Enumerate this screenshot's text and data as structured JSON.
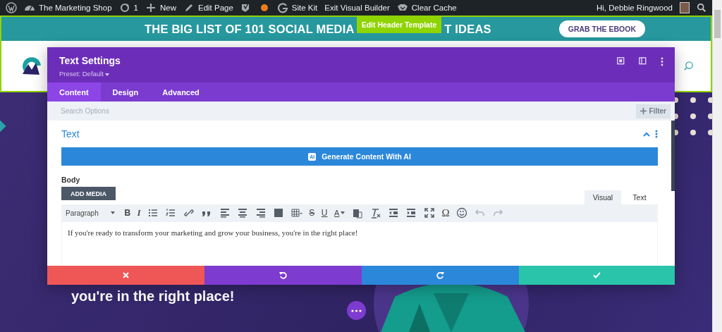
{
  "admin_bar": {
    "items": [
      {
        "kind": "wordpress"
      },
      {
        "kind": "site",
        "label": "The Marketing Shop"
      },
      {
        "kind": "updates",
        "label": "1"
      },
      {
        "kind": "new",
        "label": "New"
      },
      {
        "kind": "edit",
        "label": "Edit Page"
      },
      {
        "kind": "yoast"
      },
      {
        "kind": "status"
      },
      {
        "kind": "sitekit",
        "label": "Site Kit"
      },
      {
        "kind": "plain",
        "label": "Exit Visual Builder"
      },
      {
        "kind": "cache",
        "label": "Clear Cache"
      }
    ],
    "greeting": "Hi, Debbie Ringwood"
  },
  "promo_bar": {
    "text_before": "THE BIG LIST OF 101 SOCIAL MEDIA",
    "badge": "Edit Header Template",
    "text_after": "T IDEAS",
    "button": "GRAB THE EBOOK"
  },
  "hero": {
    "heading": "you're in the right place!"
  },
  "modal": {
    "title": "Text Settings",
    "preset": "Preset: Default",
    "tabs": [
      {
        "label": "Content",
        "selected": true
      },
      {
        "label": "Design",
        "selected": false
      },
      {
        "label": "Advanced",
        "selected": false
      }
    ],
    "search": {
      "placeholder": "Search Options"
    },
    "filter_button": "Filter",
    "section": {
      "title": "Text",
      "expanded": true
    },
    "ai_button": {
      "badge": "AI",
      "label": "Generate Content With AI"
    },
    "body_label": "Body",
    "add_media": "ADD MEDIA",
    "editor_tabs": [
      {
        "label": "Visual",
        "selected": true
      },
      {
        "label": "Text",
        "selected": false
      }
    ],
    "toolbar": [
      {
        "kind": "format",
        "label": "Paragraph",
        "disabled": false
      },
      {
        "kind": "bold",
        "label": "B",
        "disabled": false
      },
      {
        "kind": "italic",
        "label": "I",
        "disabled": false
      },
      {
        "kind": "bullets",
        "disabled": false
      },
      {
        "kind": "numbered",
        "disabled": false
      },
      {
        "kind": "link",
        "disabled": false
      },
      {
        "kind": "quote",
        "disabled": false
      },
      {
        "kind": "alignleft",
        "disabled": false
      },
      {
        "kind": "aligncenter",
        "disabled": false
      },
      {
        "kind": "alignright",
        "disabled": false
      },
      {
        "kind": "justify",
        "disabled": false
      },
      {
        "kind": "table",
        "disabled": false
      },
      {
        "kind": "strike",
        "label": "S",
        "disabled": false
      },
      {
        "kind": "underline",
        "label": "U",
        "disabled": false
      },
      {
        "kind": "color",
        "label": "A",
        "disabled": false
      },
      {
        "kind": "paste",
        "disabled": false
      },
      {
        "kind": "clear",
        "disabled": false
      },
      {
        "kind": "outdent",
        "disabled": false
      },
      {
        "kind": "indent",
        "disabled": false
      },
      {
        "kind": "fullscreen",
        "disabled": false
      },
      {
        "kind": "symbol",
        "label": "Ω",
        "disabled": false
      },
      {
        "kind": "emoji",
        "disabled": false
      },
      {
        "kind": "undo",
        "disabled": true
      },
      {
        "kind": "redo",
        "disabled": true
      }
    ],
    "content": "If you're ready to transform your marketing and grow your business, you're in the right place!"
  }
}
